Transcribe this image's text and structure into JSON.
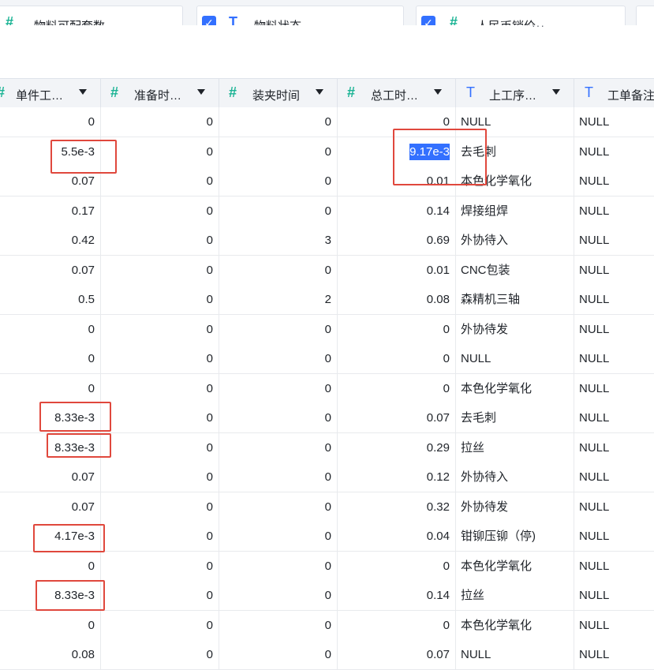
{
  "top_fields": [
    {
      "label": "物料可配套数",
      "type_icon": "hash-icon"
    },
    {
      "label": "物料状态",
      "type_icon": "text-type-icon"
    },
    {
      "label": "人民币销价…",
      "type_icon": "hash-icon"
    }
  ],
  "more_label": "···",
  "columns": [
    {
      "label": "单件工…",
      "type_icon": "hash-icon"
    },
    {
      "label": "准备时…",
      "type_icon": "hash-icon"
    },
    {
      "label": "装夹时间",
      "type_icon": "hash-icon"
    },
    {
      "label": "总工时…",
      "type_icon": "hash-icon"
    },
    {
      "label": "上工序…",
      "type_icon": "text-type-icon"
    },
    {
      "label": "工单备注",
      "type_icon": "text-type-icon"
    }
  ],
  "rows": [
    [
      "0",
      "0",
      "0",
      "0",
      "NULL",
      "NULL"
    ],
    [
      "5.5e-3",
      "0",
      "0",
      "9.17e-3",
      "去毛刺",
      "NULL"
    ],
    [
      "0.07",
      "0",
      "0",
      "0.01",
      "本色化学氧化",
      "NULL"
    ],
    [
      "0.17",
      "0",
      "0",
      "0.14",
      "焊接组焊",
      "NULL"
    ],
    [
      "0.42",
      "0",
      "3",
      "0.69",
      "外协待入",
      "NULL"
    ],
    [
      "0.07",
      "0",
      "0",
      "0.01",
      "CNC包装",
      "NULL"
    ],
    [
      "0.5",
      "0",
      "2",
      "0.08",
      "森精机三轴",
      "NULL"
    ],
    [
      "0",
      "0",
      "0",
      "0",
      "外协待发",
      "NULL"
    ],
    [
      "0",
      "0",
      "0",
      "0",
      "NULL",
      "NULL"
    ],
    [
      "0",
      "0",
      "0",
      "0",
      "本色化学氧化",
      "NULL"
    ],
    [
      "8.33e-3",
      "0",
      "0",
      "0.07",
      "去毛刺",
      "NULL"
    ],
    [
      "8.33e-3",
      "0",
      "0",
      "0.29",
      "拉丝",
      "NULL"
    ],
    [
      "0.07",
      "0",
      "0",
      "0.12",
      "外协待入",
      "NULL"
    ],
    [
      "0.07",
      "0",
      "0",
      "0.32",
      "外协待发",
      "NULL"
    ],
    [
      "4.17e-3",
      "0",
      "0",
      "0.04",
      "钳铆压铆（停)",
      "NULL"
    ],
    [
      "0",
      "0",
      "0",
      "0",
      "本色化学氧化",
      "NULL"
    ],
    [
      "8.33e-3",
      "0",
      "0",
      "0.14",
      "拉丝",
      "NULL"
    ],
    [
      "0",
      "0",
      "0",
      "0",
      "本色化学氧化",
      "NULL"
    ],
    [
      "0.08",
      "0",
      "0",
      "0.07",
      "NULL",
      "NULL"
    ]
  ],
  "selected_cell": {
    "row": 1,
    "col": 3
  },
  "colors": {
    "accent": "#3370ff",
    "number_icon": "#1ab394",
    "highlight_box": "#e0483d"
  }
}
